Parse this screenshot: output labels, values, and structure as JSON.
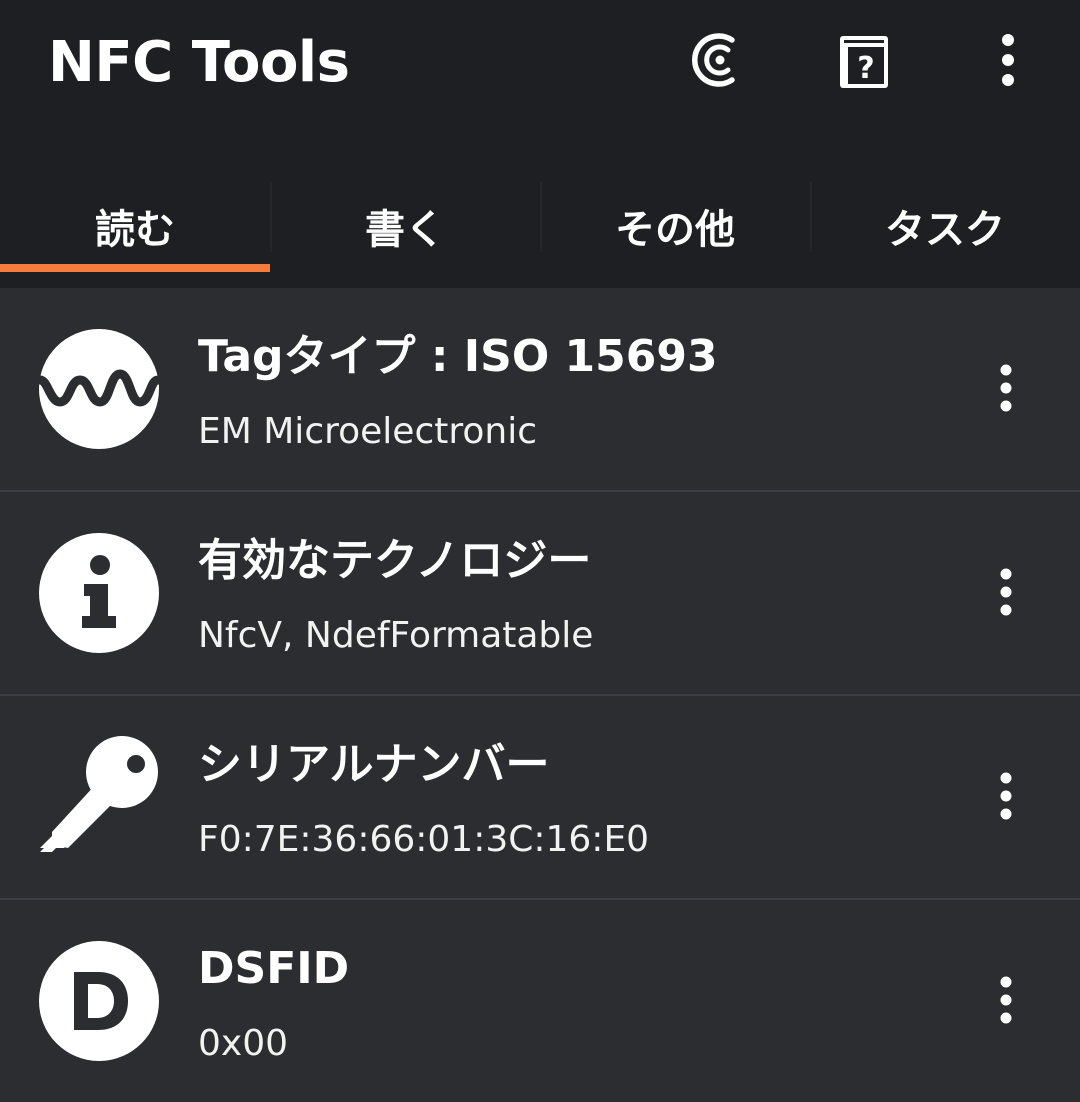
{
  "app": {
    "title": "NFC Tools"
  },
  "actions": [
    {
      "name": "nfc-history-icon"
    },
    {
      "name": "help-book-icon"
    },
    {
      "name": "more-vert-icon"
    }
  ],
  "tabs": [
    {
      "label": "読む",
      "active": true
    },
    {
      "label": "書く",
      "active": false
    },
    {
      "label": "その他",
      "active": false
    },
    {
      "label": "タスク",
      "active": false
    }
  ],
  "colors": {
    "accent": "#f57c3c",
    "appbar": "#1e1f23",
    "background": "#2c2d31"
  },
  "rows": [
    {
      "icon": "waveform-icon",
      "title": "Tagタイプ : ISO 15693",
      "subtitle": "EM Microelectronic"
    },
    {
      "icon": "info-icon",
      "title": "有効なテクノロジー",
      "subtitle": "NfcV, NdefFormatable"
    },
    {
      "icon": "key-icon",
      "title": "シリアルナンバー",
      "subtitle": "F0:7E:36:66:01:3C:16:E0"
    },
    {
      "icon": "letter-d-icon",
      "title": "DSFID",
      "subtitle": "0x00"
    }
  ]
}
